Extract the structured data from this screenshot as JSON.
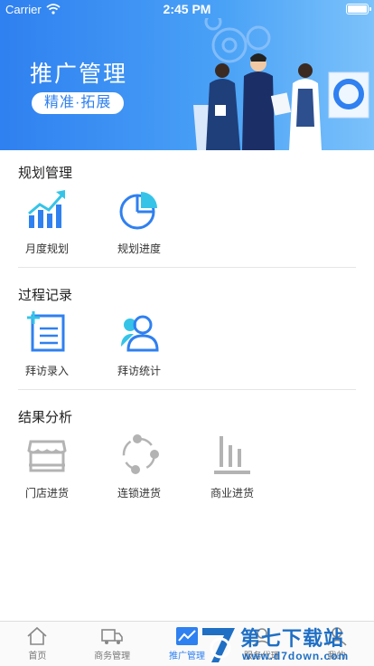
{
  "status_bar": {
    "carrier": "Carrier",
    "time": "2:45 PM"
  },
  "banner": {
    "title": "推广管理",
    "subtitle": "精准·拓展"
  },
  "sections": [
    {
      "title": "规划管理",
      "items": [
        {
          "label": "月度规划",
          "icon": "growth-chart-icon"
        },
        {
          "label": "规划进度",
          "icon": "pie-chart-icon"
        }
      ]
    },
    {
      "title": "过程记录",
      "items": [
        {
          "label": "拜访录入",
          "icon": "add-record-icon"
        },
        {
          "label": "拜访统计",
          "icon": "users-icon"
        }
      ]
    },
    {
      "title": "结果分析",
      "items": [
        {
          "label": "门店进货",
          "icon": "store-icon"
        },
        {
          "label": "连锁进货",
          "icon": "chain-icon"
        },
        {
          "label": "商业进货",
          "icon": "bar-chart-icon"
        }
      ]
    }
  ],
  "tabbar": {
    "tabs": [
      {
        "label": "首页",
        "icon": "home-icon",
        "active": false
      },
      {
        "label": "商务管理",
        "icon": "truck-icon",
        "active": false
      },
      {
        "label": "推广管理",
        "icon": "trend-icon",
        "active": true
      },
      {
        "label": "服务代理",
        "icon": "service-icon",
        "active": false
      },
      {
        "label": "我的",
        "icon": "person-icon",
        "active": false
      }
    ]
  },
  "watermark": {
    "title": "第七下载站",
    "url": "www.d7down.com"
  },
  "colors": {
    "primary": "#2f80f0",
    "accent": "#35c4e8",
    "muted": "#b3b3b3"
  }
}
